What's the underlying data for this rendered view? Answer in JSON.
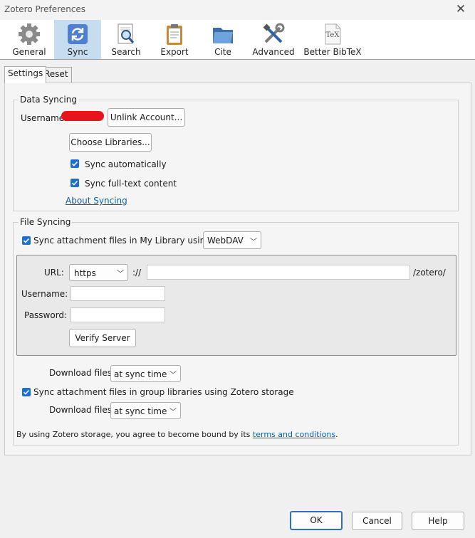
{
  "window": {
    "title": "Zotero Preferences",
    "close_icon": "close-icon"
  },
  "toolbar": {
    "items": [
      {
        "label": "General",
        "icon": "gear-icon",
        "selected": false
      },
      {
        "label": "Sync",
        "icon": "sync-icon",
        "selected": true
      },
      {
        "label": "Search",
        "icon": "search-icon",
        "selected": false
      },
      {
        "label": "Export",
        "icon": "clipboard-icon",
        "selected": false
      },
      {
        "label": "Cite",
        "icon": "folder-icon",
        "selected": false
      },
      {
        "label": "Advanced",
        "icon": "tools-icon",
        "selected": false
      },
      {
        "label": "Better BibTeX",
        "icon": "tex-icon",
        "selected": false
      }
    ]
  },
  "subtabs": [
    {
      "label": "Settings",
      "active": true
    },
    {
      "label": "Reset",
      "active": false
    }
  ],
  "data_syncing": {
    "legend": "Data Syncing",
    "username_label": "Username:",
    "unlink_button": "Unlink Account...",
    "choose_libraries_button": "Choose Libraries...",
    "sync_automatically": {
      "label": "Sync automatically",
      "checked": true
    },
    "sync_fulltext": {
      "label": "Sync full-text content",
      "checked": true
    },
    "about_link": "About Syncing"
  },
  "file_syncing": {
    "legend": "File Syncing",
    "sync_attachments_my_library": {
      "label": "Sync attachment files in My Library using",
      "checked": true
    },
    "method_select": "WebDAV",
    "url_label": "URL:",
    "protocol_select": "https",
    "url_separator": "://",
    "url_value": "",
    "url_suffix": "/zotero/",
    "username_label": "Username:",
    "username_value": "",
    "password_label": "Password:",
    "password_value": "",
    "verify_button": "Verify Server",
    "download_files_label": "Download files",
    "download_files_select": "at sync time",
    "sync_group_libraries": {
      "label": "Sync attachment files in group libraries using Zotero storage",
      "checked": true
    },
    "group_download_label": "Download files",
    "group_download_select": "at sync time",
    "terms_text": "By using Zotero storage, you agree to become bound by its",
    "terms_link": "terms and conditions",
    "terms_end": "."
  },
  "footer": {
    "ok": "OK",
    "cancel": "Cancel",
    "help": "Help"
  },
  "colors": {
    "accent": "#1f6fd0",
    "selected_tab": "#c8dcf0",
    "link": "#0a5fb4",
    "redaction": "#e8141c"
  }
}
